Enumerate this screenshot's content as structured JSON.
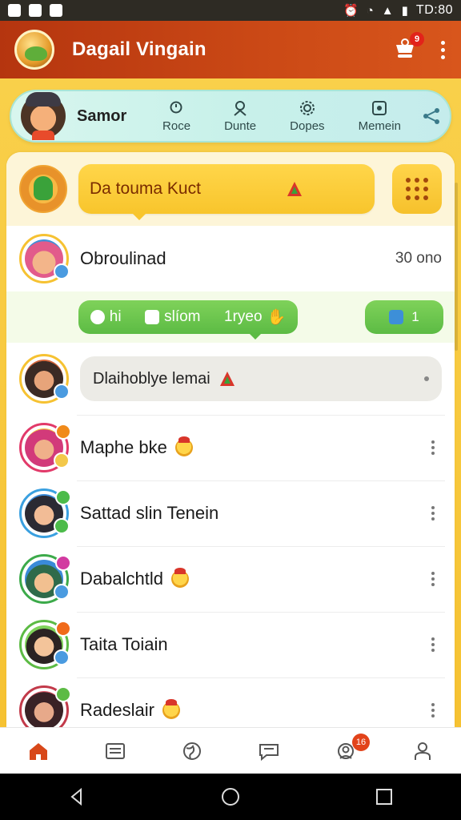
{
  "status_bar": {
    "time": "TD:80",
    "left_icons": [
      "gallery-icon",
      "cloud-icon",
      "messenger-icon"
    ],
    "right_icons": [
      "alarm-icon",
      "wifi-icon",
      "signal-icon",
      "battery-icon"
    ]
  },
  "app_bar": {
    "title": "Dagail Vingain",
    "cart_badge": "9",
    "colors": {
      "bar": "#c4410f",
      "accent": "#f6c232"
    }
  },
  "profile": {
    "name": "Samor",
    "tabs": [
      {
        "label": "Roce",
        "icon": "search-icon"
      },
      {
        "label": "Dunte",
        "icon": "person-icon"
      },
      {
        "label": "Dopes",
        "icon": "gear-icon"
      },
      {
        "label": "Memein",
        "icon": "frame-icon"
      }
    ],
    "share_icon": "share-icon"
  },
  "composer": {
    "bubble_text": "Da touma Kuct",
    "grid_icon": "grid-icon"
  },
  "first_contact": {
    "name": "Obroulinad",
    "meta": "30 ono"
  },
  "chips": {
    "items": [
      {
        "label": "hi"
      },
      {
        "label": "slíom"
      },
      {
        "label": "1ryeo"
      }
    ],
    "mini_label": "1"
  },
  "message": {
    "text": "Dlaihoblye lemai"
  },
  "contacts": [
    {
      "name": "Maphe bke",
      "emoji": true
    },
    {
      "name": "Sattad slin Tenein",
      "emoji": false
    },
    {
      "name": "Dabalchtld",
      "emoji": true
    },
    {
      "name": "Taita Toiain",
      "emoji": false
    },
    {
      "name": "Radeslair",
      "emoji": true
    }
  ],
  "bottom_nav": {
    "items": [
      "home-icon",
      "news-icon",
      "globe-icon",
      "chat-icon",
      "support-icon",
      "profile-icon"
    ],
    "support_badge": "16"
  }
}
